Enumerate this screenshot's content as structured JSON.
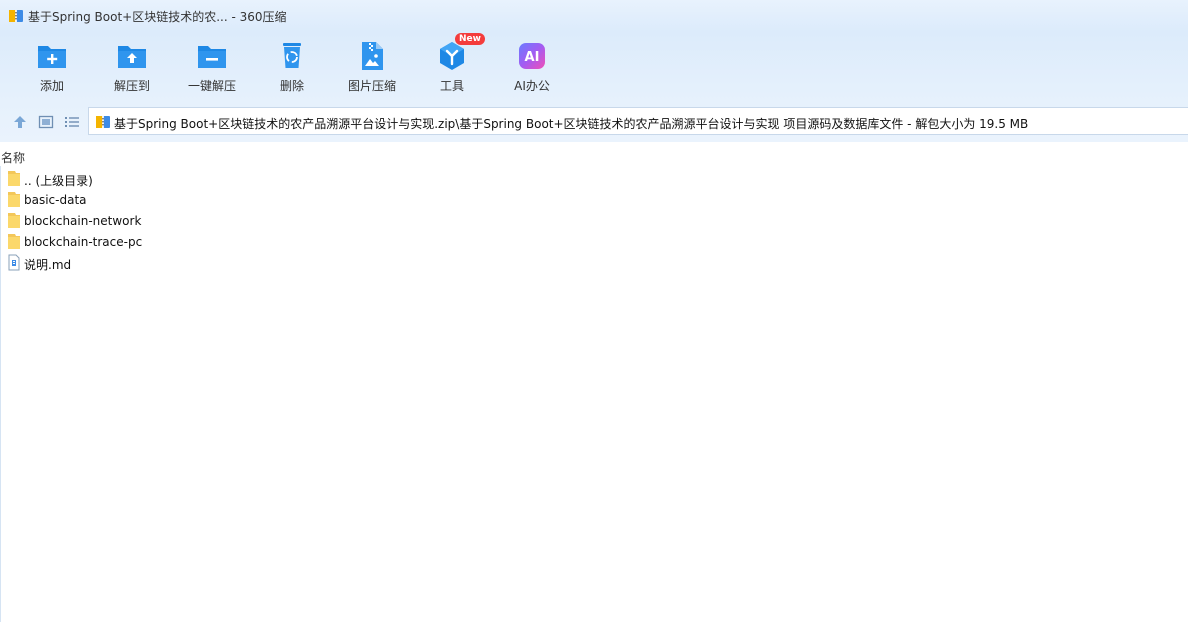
{
  "window": {
    "title": "基于Spring Boot+区块链技术的农... - 360压缩"
  },
  "toolbar": {
    "add_label": "添加",
    "extract_to_label": "解压到",
    "one_click_extract_label": "一键解压",
    "delete_label": "删除",
    "image_compress_label": "图片压缩",
    "tools_label": "工具",
    "tools_badge": "New",
    "ai_office_label": "AI办公",
    "ai_icon_text": "AI"
  },
  "address_bar": {
    "path": "基于Spring Boot+区块链技术的农产品溯源平台设计与实现.zip\\基于Spring Boot+区块链技术的农产品溯源平台设计与实现 项目源码及数据库文件 - 解包大小为 19.5 MB"
  },
  "file_list": {
    "column_name": "名称",
    "items": [
      {
        "name": ".. (上级目录)",
        "icon": "folder-icon"
      },
      {
        "name": "basic-data",
        "icon": "folder-icon"
      },
      {
        "name": "blockchain-network",
        "icon": "folder-icon"
      },
      {
        "name": "blockchain-trace-pc",
        "icon": "folder-icon"
      },
      {
        "name": "说明.md",
        "icon": "file-icon"
      }
    ]
  },
  "colors": {
    "accent_blue": "#1e88e5",
    "folder_yellow": "#fbd86b",
    "badge_red": "#f43c3c",
    "ai_gradient_start": "#8a5cf6",
    "ai_gradient_end": "#e14eca"
  }
}
